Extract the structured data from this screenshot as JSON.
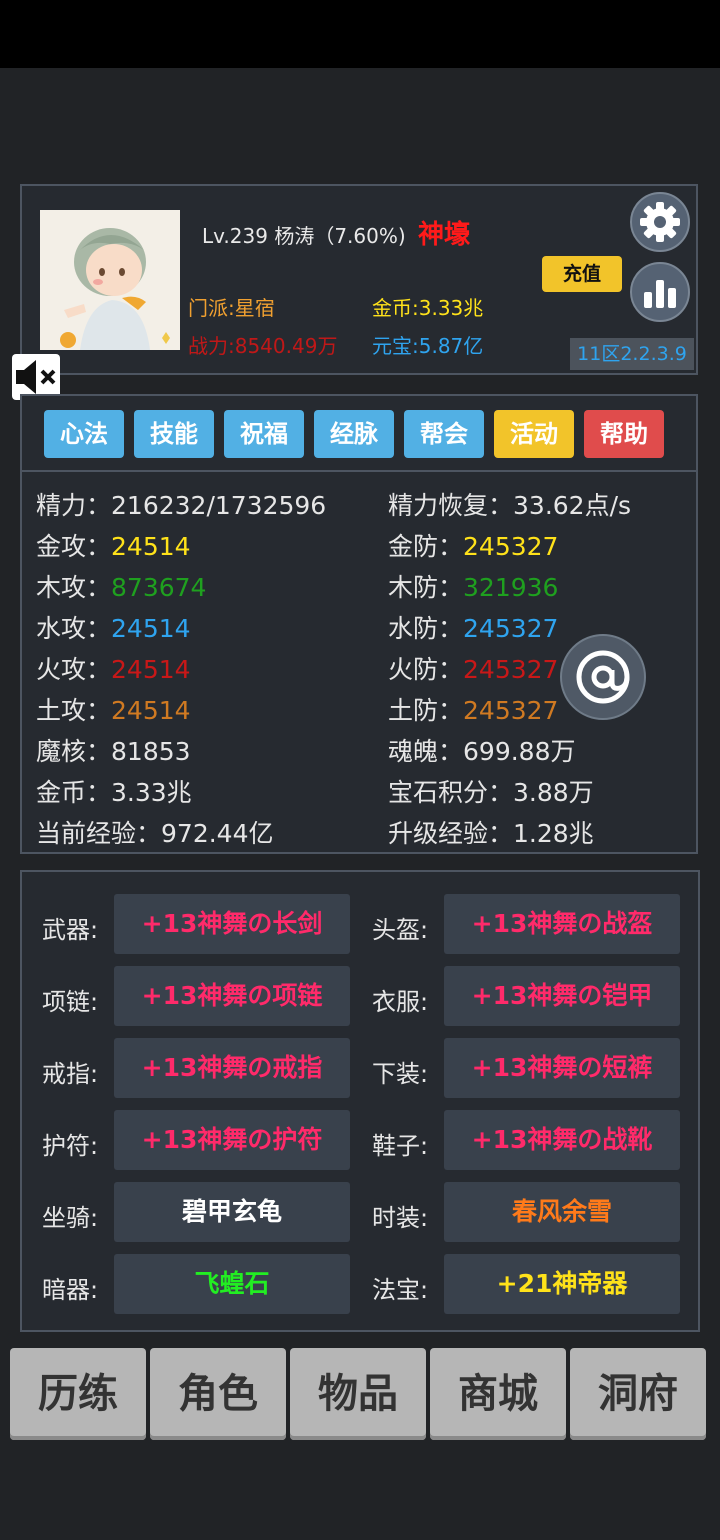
{
  "profile": {
    "level_line": "Lv.239 杨涛（7.60%)",
    "rank_title": "神壕",
    "sect": "门派:星宿",
    "power": "战力:8540.49万",
    "gold": "金币:3.33兆",
    "yuanbao": "元宝:5.87亿",
    "recharge_label": "充值",
    "server": "11区2.2.3.9"
  },
  "icons": {
    "settings": "gear-icon",
    "ranking": "bar-chart-icon",
    "sound": "mute-icon",
    "social": "at-icon"
  },
  "tabs": [
    {
      "label": "心法",
      "color": "#52b0e4"
    },
    {
      "label": "技能",
      "color": "#52b0e4"
    },
    {
      "label": "祝福",
      "color": "#52b0e4"
    },
    {
      "label": "经脉",
      "color": "#52b0e4"
    },
    {
      "label": "帮会",
      "color": "#52b0e4"
    },
    {
      "label": "活动",
      "color": "#f2c42a"
    },
    {
      "label": "帮助",
      "color": "#e04c4c"
    }
  ],
  "attributes": {
    "energy": {
      "label": "精力：",
      "value": "216232/1732596"
    },
    "energy_regen": {
      "label": "精力恢复：",
      "value": "33.62点/s"
    },
    "metal_atk": {
      "label": "金攻：",
      "value": "24514",
      "color": "#ffe21a"
    },
    "metal_def": {
      "label": "金防：",
      "value": "245327",
      "color": "#ffe21a"
    },
    "wood_atk": {
      "label": "木攻：",
      "value": "873674",
      "color": "#1fa01f"
    },
    "wood_def": {
      "label": "木防：",
      "value": "321936",
      "color": "#1fa01f"
    },
    "water_atk": {
      "label": "水攻：",
      "value": "24514",
      "color": "#2fa4ef"
    },
    "water_def": {
      "label": "水防：",
      "value": "245327",
      "color": "#2fa4ef"
    },
    "fire_atk": {
      "label": "火攻：",
      "value": "24514",
      "color": "#c81818"
    },
    "fire_def": {
      "label": "火防：",
      "value": "245327",
      "color": "#c81818"
    },
    "earth_atk": {
      "label": "土攻：",
      "value": "24514",
      "color": "#d07a22"
    },
    "earth_def": {
      "label": "土防：",
      "value": "245327",
      "color": "#d07a22"
    },
    "magic_core": {
      "label": "魔核：",
      "value": "81853"
    },
    "soul": {
      "label": "魂魄：",
      "value": "699.88万"
    },
    "coins": {
      "label": "金币：",
      "value": "3.33兆"
    },
    "gem_points": {
      "label": "宝石积分：",
      "value": "3.88万"
    },
    "current_exp": {
      "label": "当前经验：",
      "value": "972.44亿"
    },
    "levelup_exp": {
      "label": "升级经验：",
      "value": "1.28兆"
    }
  },
  "equipment": {
    "weapon": {
      "label": "武器:",
      "item": "+13神舞の长剑",
      "color": "#ff2a6a"
    },
    "helmet": {
      "label": "头盔:",
      "item": "+13神舞の战盔",
      "color": "#ff2a6a"
    },
    "necklace": {
      "label": "项链:",
      "item": "+13神舞の项链",
      "color": "#ff2a6a"
    },
    "armor": {
      "label": "衣服:",
      "item": "+13神舞の铠甲",
      "color": "#ff2a6a"
    },
    "ring": {
      "label": "戒指:",
      "item": "+13神舞の戒指",
      "color": "#ff2a6a"
    },
    "pants": {
      "label": "下装:",
      "item": "+13神舞の短裤",
      "color": "#ff2a6a"
    },
    "amulet": {
      "label": "护符:",
      "item": "+13神舞の护符",
      "color": "#ff2a6a"
    },
    "shoes": {
      "label": "鞋子:",
      "item": "+13神舞の战靴",
      "color": "#ff2a6a"
    },
    "mount": {
      "label": "坐骑:",
      "item": "碧甲玄龟",
      "color": "#ffffff"
    },
    "fashion": {
      "label": "时装:",
      "item": "春风余雪",
      "color": "#ff7a1a"
    },
    "hidden_weapon": {
      "label": "暗器:",
      "item": "飞蝗石",
      "color": "#22ee22"
    },
    "treasure": {
      "label": "法宝:",
      "item": "+21神帝器",
      "color": "#ffe21a"
    }
  },
  "bottom_nav": [
    "历练",
    "角色",
    "物品",
    "商城",
    "洞府"
  ]
}
